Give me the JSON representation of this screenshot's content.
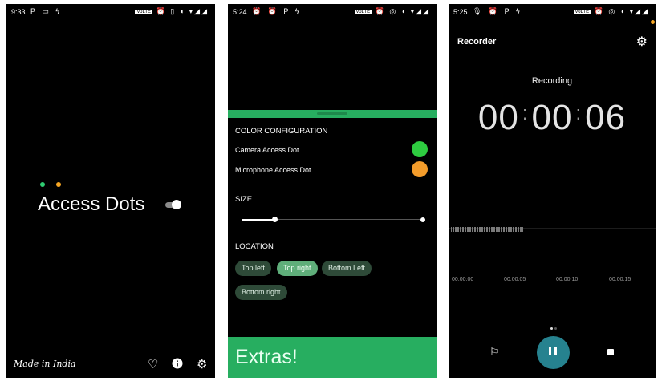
{
  "screen1": {
    "time": "9:33",
    "status_left_icons": "P ▭ ϟ",
    "status_right_icons": "⏰ ▯ ◖ ▾◢◢",
    "status_badge": "VoLTE",
    "title": "Access Dots",
    "camera_dot_color": "#2ecc71",
    "mic_dot_color": "#f5a623",
    "toggle_on": true,
    "footer_text": "Made in India",
    "footer_icons": [
      "heart-icon",
      "info-icon",
      "gear-icon"
    ]
  },
  "screen2": {
    "time": "5:24",
    "status_left_icons": "⏰ ⏰ P ϟ",
    "status_right_icons": "⏰ ◎ ◖ ▾◢◢",
    "status_badge": "VoLTE",
    "color_section": "COLOR CONFIGURATION",
    "camera_label": "Camera Access Dot",
    "camera_color": "#2ecc40",
    "mic_label": "Microphone Access Dot",
    "mic_color": "#f39c2b",
    "size_section": "SIZE",
    "size_value": 0.18,
    "location_section": "LOCATION",
    "location_options": [
      {
        "label": "Top left",
        "selected": false
      },
      {
        "label": "Top right",
        "selected": true
      },
      {
        "label": "Bottom Left",
        "selected": false
      },
      {
        "label": "Bottom right",
        "selected": false
      }
    ],
    "extras_label": "Extras!",
    "accent_color": "#27ae60"
  },
  "screen3": {
    "time": "5:25",
    "status_left_icons": "🎙 ⏰ P ϟ",
    "status_right_icons": "⏰ ◎ ◖ ▾◢◢",
    "status_badge": "VoLTE",
    "app_title": "Recorder",
    "status": "Recording",
    "timer": {
      "hours": "00",
      "minutes": "00",
      "seconds": "06"
    },
    "timeline_ticks": [
      "00:00:00",
      "00:00:05",
      "00:00:10",
      "00:00:15"
    ],
    "pause_button_color": "#26828f"
  }
}
